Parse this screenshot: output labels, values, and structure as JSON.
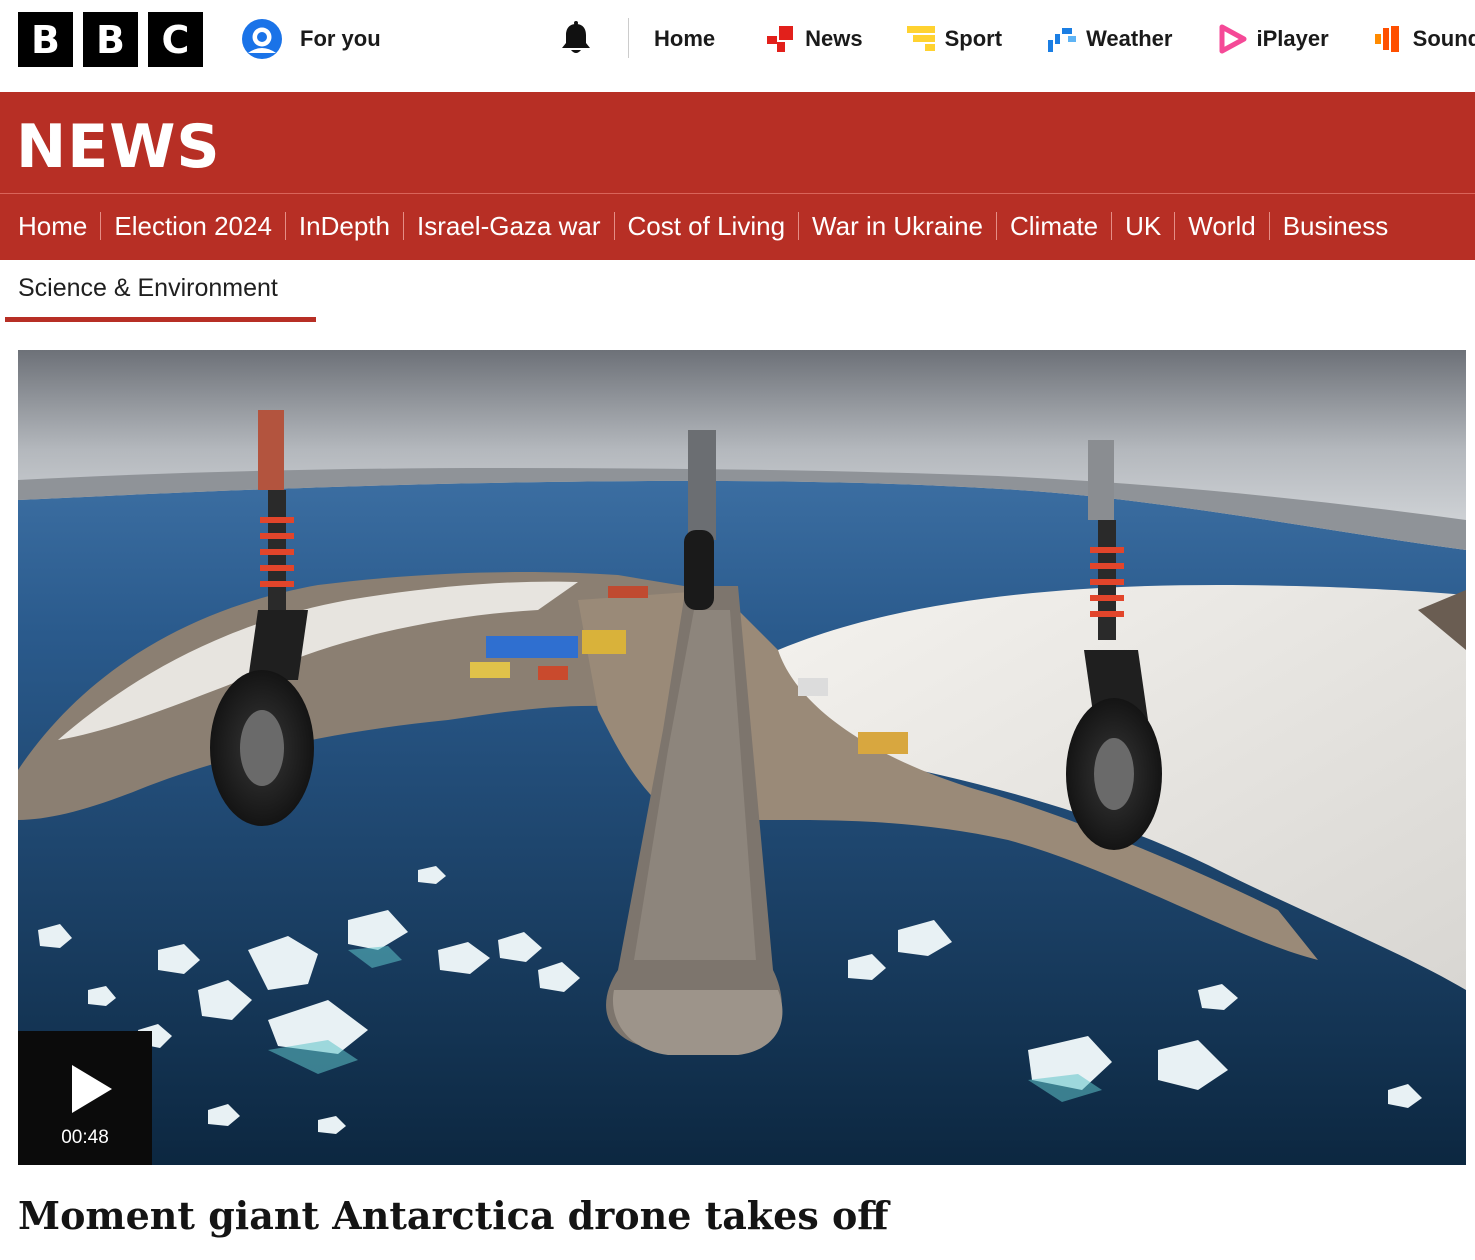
{
  "brand": {
    "letters": [
      "B",
      "B",
      "C"
    ]
  },
  "masthead": {
    "for_you_label": "For you",
    "nav": [
      {
        "label": "Home",
        "icon": "none"
      },
      {
        "label": "News",
        "icon": "news-icon"
      },
      {
        "label": "Sport",
        "icon": "sport-icon"
      },
      {
        "label": "Weather",
        "icon": "weather-icon"
      },
      {
        "label": "iPlayer",
        "icon": "iplayer-icon"
      },
      {
        "label": "Sounds",
        "icon": "sounds-icon"
      }
    ]
  },
  "news_header": {
    "title": "NEWS",
    "sections": [
      "Home",
      "Election 2024",
      "InDepth",
      "Israel-Gaza war",
      "Cost of Living",
      "War in Ukraine",
      "Climate",
      "UK",
      "World",
      "Business"
    ]
  },
  "subnav": {
    "active": "Science & Environment"
  },
  "video": {
    "duration": "00:48",
    "play_icon": "play-icon"
  },
  "article": {
    "headline": "Moment giant Antarctica drone takes off"
  },
  "colors": {
    "news_red": "#b72f25",
    "news_icon": "#e2201b",
    "sport_icon": "#ffd230",
    "weather_icon": "#1b7ee3",
    "iplayer_icon": "#f54997",
    "sounds_icon": "#ff4f00"
  }
}
